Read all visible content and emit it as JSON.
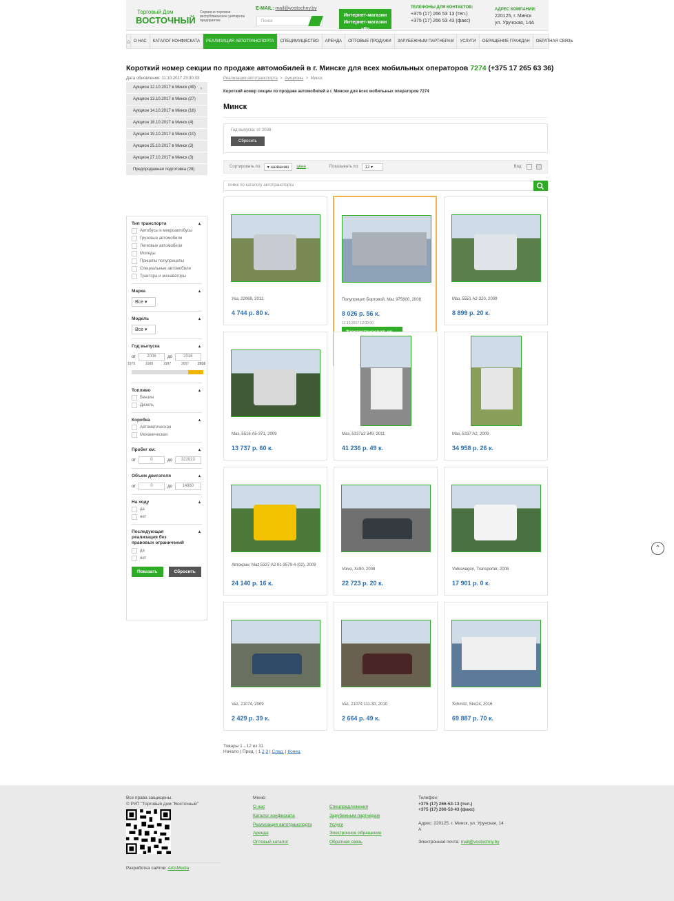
{
  "header": {
    "logo_line1": "Торговый Дом",
    "logo_line2": "ВОСТОЧНЫЙ",
    "tagline": "Сервисно торговое республиканское унитарное предприятие",
    "email_label": "E-MAIL:",
    "email": "mail@vostochny.by",
    "search_placeholder": "Поиск",
    "shop_button": "Интернет-магазин Интернет-магазин «Ва",
    "phones_label": "ТЕЛЕФОНЫ ДЛЯ КОНТАКТОВ:",
    "phone1": "+375 (17) 266 53 13 (тел.)",
    "phone2": "+375 (17) 266 53 43 (факс)",
    "address_label": "АДРЕС КОМПАНИИ:",
    "address1": "220125, г. Минск",
    "address2": "ул. Уручская, 14А"
  },
  "nav": [
    "О НАС",
    "КАТАЛОГ КОНФИСКАТА",
    "РЕАЛИЗАЦИЯ АВТОТРАНСПОРТА",
    "СПЕЦИМУЩЕСТВО",
    "АРЕНДА",
    "ОПТОВЫЕ ПРОДАЖИ",
    "ЗАРУБЕЖНЫМ ПАРТНЕРАМ",
    "УСЛУГИ",
    "ОБРАЩЕНИЕ ГРАЖДАН",
    "ОБРАТНАЯ СВЯЗЬ"
  ],
  "page": {
    "heading": "Короткий номер секции по продаже автомобилей в г. Минске для всех мобильных операторов",
    "heading_num": "7274",
    "heading_phone": "(+375 17 265 63 36)",
    "updated": "Дата обновления: 11.10.2017 23:30:33",
    "breadcrumb": [
      "Реализация автотранспорта",
      "Аукционы",
      "Минск"
    ],
    "subtitle": "Короткий номер секции по продаже автомобилей в г. Минске для всех мобильных операторов 7274",
    "title": "Минск"
  },
  "sidemenu": [
    "Аукцион 12.10.2017 в Минск (49)",
    "Аукцион 13.10.2017 в Минск (27)",
    "Аукцион 14.10.2017 в Минск (16)",
    "Аукцион 18.10.2017 в Минск (4)",
    "Аукцион 19.10.2017 в Минск (10)",
    "Аукцион 25.10.2017 в Минск (3)",
    "Аукцион 27.10.2017 в Минск (3)",
    "Предпродажная подготовка (28)"
  ],
  "filter": {
    "type_title": "Тип транспорта",
    "types": [
      "Автобусы и микроавтобусы",
      "Грузовые автомобили",
      "Легковые автомобили",
      "Мопеды",
      "Прицепы полуприцепы",
      "Специальные автомобили",
      "Трактора и экскаваторы"
    ],
    "brand_title": "Марка",
    "brand_value": "Все",
    "model_title": "Модель",
    "model_value": "Все",
    "year_title": "Год выпуска",
    "from": "от",
    "to": "до",
    "year_from": "2008",
    "year_to": "2016",
    "year_ticks": [
      "1978",
      "1988",
      "1997",
      "2007",
      "2016"
    ],
    "fuel_title": "Топливо",
    "fuels": [
      "Бензин",
      "Дизель"
    ],
    "gear_title": "Коробка",
    "gears": [
      "Автоматическая",
      "Механическая"
    ],
    "mileage_title": "Пробег км.",
    "mileage_from": "0",
    "mileage_to": "322023",
    "engine_title": "Объем двигателя",
    "engine_from": "0",
    "engine_to": "14860",
    "running_title": "На ходу",
    "running": [
      "да",
      "нет"
    ],
    "last_title": "Последующая реализация без правовых ограничений",
    "last": [
      "да",
      "нет"
    ],
    "show_btn": "Показать",
    "reset_btn": "Сбросить"
  },
  "active_filter": {
    "text": "Год выпуска: от 2008",
    "reset": "Сбросить"
  },
  "sortbar": {
    "sort_label": "Сортировать по:",
    "sort_value": "названию",
    "price": "цене",
    "show_label": "Показывать по:",
    "show_value": "12",
    "view_label": "Вид:"
  },
  "catalog_search": "поиск по каталогу автотранспорта",
  "products": [
    {
      "name": "Уаз, 22069, 2012",
      "price": "4 744 р. 80 к."
    },
    {
      "name": "Полуприцеп Бортовой, Maz 975800, 2008",
      "price": "8 026 р. 56 к.",
      "date": "12.10.2017 12:00:00",
      "register": "Зарегистрироваться",
      "details": "Подробно"
    },
    {
      "name": "Maз, 5551 А2-320, 2009",
      "price": "8 899 р. 20 к."
    },
    {
      "name": "Maз, 5516 А5-371, 2009",
      "price": "13 737 р. 60 к."
    },
    {
      "name": "Maз, 5337а2 349, 2011",
      "price": "41 236 р. 49 к."
    },
    {
      "name": "Maз, 5337 А2, 2009",
      "price": "34 958 р. 26 к."
    },
    {
      "name": "Автокран, Maz 5337 А2 Кс-3579-4-(02), 2009",
      "price": "24 140 р. 16 к."
    },
    {
      "name": "Volvo, Xc90, 2008",
      "price": "22 723 р. 20 к."
    },
    {
      "name": "Volkswagen, Transporter, 2008",
      "price": "17 901 р. 0 к."
    },
    {
      "name": "Vaz, 21074, 2009",
      "price": "2 429 р. 39 к."
    },
    {
      "name": "Vaz, 21074 111-30, 2010",
      "price": "2 664 р. 49 к."
    },
    {
      "name": "Schmitz, Sko24, 2016",
      "price": "69 887 р. 70 к."
    }
  ],
  "pagination": {
    "count": "Товары 1 - 12 из 31",
    "start": "Начало",
    "prev": "Пред.",
    "p1": "1",
    "p2": "2",
    "p3": "3",
    "next": "След.",
    "end": "Конец"
  },
  "footer": {
    "rights": "Все права защищены.",
    "company": "© РУП \"Торговый дом \"Восточный\"",
    "dev_label": "Разработка сайтов:",
    "dev": "ArtisMedia",
    "menu_title": "Меню:",
    "menu_col1": [
      "О нас",
      "Каталог конфиската",
      "Реализация автотранспорта",
      "Аренда",
      "Оптовый каталог"
    ],
    "menu_col2": [
      "Спецпредложения",
      "Зарубежным партнерам",
      "Услуги",
      "Электронное обращение",
      "Обратная связь"
    ],
    "phone_title": "Телефон:",
    "phone1": "+375 (17) 266-53-13 (тел.)",
    "phone2": "+375 (17) 266-53-43 (факс)",
    "address": "Адрес: 220125, г. Минск, ул. Уручская, 14 А",
    "email_label": "Электронная почта:",
    "email": "mail@vostochny.by"
  }
}
